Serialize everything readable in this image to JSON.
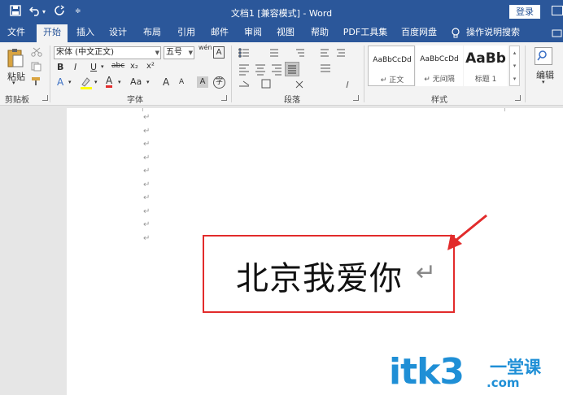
{
  "titlebar": {
    "title": "文档1 [兼容模式] - Word",
    "login": "登录",
    "qa_save_icon": "save-icon",
    "qa_undo_icon": "undo-icon",
    "qa_redo_icon": "redo-icon"
  },
  "tabs": [
    {
      "label": "文件"
    },
    {
      "label": "开始"
    },
    {
      "label": "插入"
    },
    {
      "label": "设计"
    },
    {
      "label": "布局"
    },
    {
      "label": "引用"
    },
    {
      "label": "邮件"
    },
    {
      "label": "审阅"
    },
    {
      "label": "视图"
    },
    {
      "label": "帮助"
    },
    {
      "label": "PDF工具集"
    },
    {
      "label": "百度网盘"
    },
    {
      "label": "操作说明搜索"
    }
  ],
  "ribbon": {
    "clipboard": {
      "paste": "粘贴",
      "label": "剪贴板"
    },
    "font": {
      "name": "宋体 (中文正文)",
      "size": "五号",
      "label": "字体",
      "bold": "B",
      "italic": "I",
      "underline": "U",
      "strike": "abc",
      "sub": "x₂",
      "sup": "x²",
      "font_color": "A",
      "case": "Aa",
      "grow": "A",
      "shrink": "A",
      "pinyin": "wén",
      "char_border": "A",
      "char_shade": "A",
      "enclose": "字"
    },
    "paragraph": {
      "label": "段落"
    },
    "styles": {
      "label": "样式",
      "items": [
        {
          "preview": "AaBbCcDd",
          "name": "↵ 正文"
        },
        {
          "preview": "AaBbCcDd",
          "name": "↵ 无间隔"
        },
        {
          "preview": "AaBb",
          "name": "标题 1"
        }
      ]
    },
    "editing": {
      "label": "编辑"
    }
  },
  "document": {
    "text": "北京我爱你",
    "para_mark": "↵"
  },
  "watermark": {
    "main": "itk3",
    "cn": "一堂课",
    "com": ".com"
  },
  "colors": {
    "accent": "#2b579a",
    "highlight_box": "#e22b2b",
    "watermark": "#1f8fd6"
  }
}
